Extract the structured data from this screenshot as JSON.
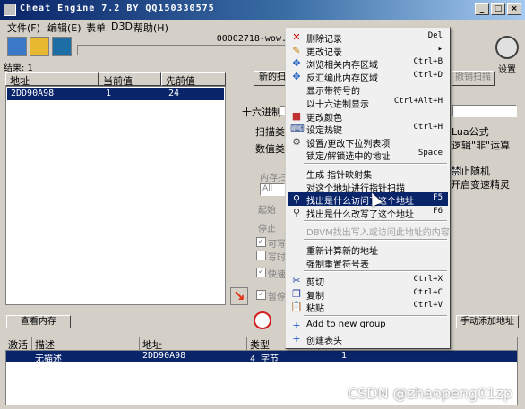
{
  "window": {
    "title": "Cheat Engine 7.2 BY QQ150330575"
  },
  "menubar": [
    "文件(F)",
    "编辑(E)",
    "表单",
    "D3D",
    "帮助(H)"
  ],
  "process_label": "00002718-wow.",
  "found_count": "结果: 1",
  "found_list": {
    "headers": [
      "地址",
      "当前值",
      "先前值"
    ],
    "rows": [
      {
        "address": "2DD90A98",
        "current": "1",
        "previous": "24"
      }
    ]
  },
  "scan": {
    "new_scan": "新的扫",
    "undo_scan": "撤销扫描",
    "hex_label": "十六进制",
    "scan_type_label": "扫描类",
    "value_type_label": "数值类",
    "memory_scan_label": "内存扫",
    "all_value": "All",
    "start_label": "起始",
    "stop_label": "停止",
    "writable_label": "可写",
    "copy_on_write_label": "写时",
    "fast_scan_label": "快速",
    "pause_label": "暂停",
    "lua_formula": "Lua公式",
    "logic_not": "逻辑\"非\"运算",
    "random_label": "禁止随机",
    "speedhack_label": "开启变速精灵"
  },
  "settings_label": "设置",
  "view_memory_button": "查看内存",
  "add_address_button": "手动添加地址",
  "cheat_table": {
    "headers": [
      "激活",
      "描述",
      "地址",
      "类型",
      "数值"
    ],
    "rows": [
      {
        "active": "",
        "description": "无描述",
        "address": "2DD90A98",
        "type": "4 字节",
        "value": "1"
      }
    ]
  },
  "context_menu": [
    {
      "icon": "delete-icon",
      "glyph": "✕",
      "color": "#d00000",
      "label": "删除记录",
      "shortcut": "Del"
    },
    {
      "icon": "edit-icon",
      "glyph": "✎",
      "color": "#c08000",
      "label": "更改记录",
      "shortcut": "▸"
    },
    {
      "icon": "browse-memory-icon",
      "glyph": "✥",
      "color": "#2060c0",
      "label": "浏览相关内存区域",
      "shortcut": "Ctrl+B"
    },
    {
      "icon": "disassemble-icon",
      "glyph": "✥",
      "color": "#2060c0",
      "label": "反汇编此内存区域",
      "shortcut": "Ctrl+D"
    },
    {
      "icon": "",
      "glyph": "",
      "color": "#000",
      "label": "显示带符号的",
      "shortcut": ""
    },
    {
      "icon": "",
      "glyph": "",
      "color": "#000",
      "label": "以十六进制显示",
      "shortcut": "Ctrl+Alt+H"
    },
    {
      "icon": "color-icon",
      "glyph": "■",
      "color": "#c03030",
      "label": "更改颜色",
      "shortcut": ""
    },
    {
      "icon": "hotkey-icon",
      "glyph": "⌨",
      "color": "#305090",
      "label": "设定热键",
      "shortcut": "Ctrl+H"
    },
    {
      "icon": "dropdown-icon",
      "glyph": "⚙",
      "color": "#505050",
      "label": "设置/更改下拉列表项",
      "shortcut": ""
    },
    {
      "icon": "",
      "glyph": "",
      "color": "#000",
      "label": "锁定/解锁选中的地址",
      "shortcut": "Space"
    },
    {
      "sep": true
    },
    {
      "icon": "",
      "glyph": "",
      "color": "#000",
      "label": "生成 指针映射集",
      "shortcut": ""
    },
    {
      "icon": "",
      "glyph": "",
      "color": "#000",
      "label": "对这个地址进行指针扫描",
      "shortcut": ""
    },
    {
      "icon": "find-access-icon",
      "glyph": "⚲",
      "color": "#303030",
      "label": "找出是什么访问了这个地址",
      "shortcut": "F5",
      "selected": true
    },
    {
      "icon": "find-write-icon",
      "glyph": "⚲",
      "color": "#303030",
      "label": "找出是什么改写了这个地址",
      "shortcut": "F6"
    },
    {
      "sep": true
    },
    {
      "icon": "",
      "glyph": "",
      "color": "#000",
      "label": "DBVM找出写入或访问此地址的内容",
      "shortcut": "",
      "disabled": true
    },
    {
      "sep": true
    },
    {
      "icon": "",
      "glyph": "",
      "color": "#000",
      "label": "重新计算新的地址",
      "shortcut": ""
    },
    {
      "icon": "",
      "glyph": "",
      "color": "#000",
      "label": "强制重置符号表",
      "shortcut": ""
    },
    {
      "sep": true
    },
    {
      "icon": "cut-icon",
      "glyph": "✂",
      "color": "#2040a0",
      "label": "剪切",
      "shortcut": "Ctrl+X"
    },
    {
      "icon": "copy-icon",
      "glyph": "❐",
      "color": "#2040a0",
      "label": "复制",
      "shortcut": "Ctrl+C"
    },
    {
      "icon": "paste-icon",
      "glyph": "📋",
      "color": "#806020",
      "label": "粘贴",
      "shortcut": "Ctrl+V"
    },
    {
      "sep": true
    },
    {
      "icon": "add-group-icon",
      "glyph": "+",
      "color": "#2060d0",
      "label": "Add to new group",
      "shortcut": ""
    },
    {
      "icon": "create-header-icon",
      "glyph": "+",
      "color": "#2060d0",
      "label": "创建表头",
      "shortcut": ""
    }
  ],
  "watermark": "CSDN @zhaopeng01zp"
}
